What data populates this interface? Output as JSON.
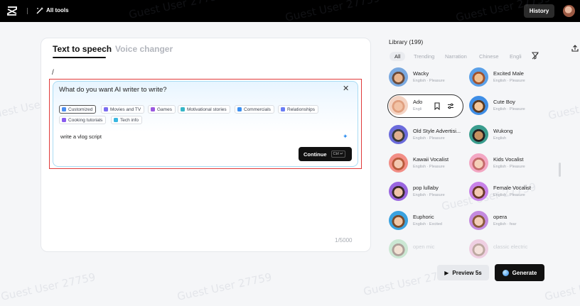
{
  "topbar": {
    "all_tools_label": "All tools",
    "history_label": "History"
  },
  "watermark_text": "Guest User 27759",
  "editor": {
    "tabs": [
      {
        "label": "Text to speech",
        "active": true
      },
      {
        "label": "Voice changer",
        "active": false
      }
    ],
    "text_content": "/",
    "char_counter": "1/5000"
  },
  "ai_writer": {
    "title": "What do you want AI writer to write?",
    "chips": [
      {
        "label": "Customized",
        "active": true,
        "color": "#4a8df0"
      },
      {
        "label": "Movies and TV",
        "active": false,
        "color": "#7a6cf0"
      },
      {
        "label": "Games",
        "active": false,
        "color": "#9b59e0"
      },
      {
        "label": "Motivational stories",
        "active": false,
        "color": "#36b6c8"
      },
      {
        "label": "Commercials",
        "active": false,
        "color": "#3b8ff0"
      },
      {
        "label": "Relationships",
        "active": false,
        "color": "#6a7df5"
      },
      {
        "label": "Cooking tutorials",
        "active": false,
        "color": "#8a5cf0"
      },
      {
        "label": "Tech info",
        "active": false,
        "color": "#3ab7e0"
      }
    ],
    "prompt_text": "write a vlog script",
    "continue_label": "Continue",
    "shortcut_label": "Ctrl ↵"
  },
  "library": {
    "title": "Library (199)",
    "filters": [
      {
        "label": "All",
        "active": true
      },
      {
        "label": "Trending",
        "active": false
      },
      {
        "label": "Narration",
        "active": false
      },
      {
        "label": "Chinese",
        "active": false
      },
      {
        "label": "Engli",
        "active": false
      }
    ],
    "voices": [
      {
        "name": "Wacky",
        "sub": "English · Pleasure",
        "skin": "#e9b58e",
        "hair": "#6a4a3a",
        "bg": "#7aa9e0"
      },
      {
        "name": "Excited Male",
        "sub": "English · Pleasure",
        "skin": "#f0c090",
        "hair": "#a0522d",
        "bg": "#5aa0e8"
      },
      {
        "name": "Ado",
        "sub": "Engli",
        "skin": "#f2c2a5",
        "hair": "#e0a080",
        "bg": "#f4d4c4"
      },
      {
        "name": "Cute Boy",
        "sub": "English · Pleasure",
        "skin": "#f5c79a",
        "hair": "#5a3a22",
        "bg": "#3f8ee6"
      },
      {
        "name": "Old Style Advertisi...",
        "sub": "English · Pleasure",
        "skin": "#e0b090",
        "hair": "#3a3a3a",
        "bg": "#6b6bdc"
      },
      {
        "name": "Wukong",
        "sub": "English",
        "skin": "#c69060",
        "hair": "#222222",
        "bg": "#3a9d8e"
      },
      {
        "name": "Kawaii Vocalist",
        "sub": "English · Pleasure",
        "skin": "#f3c8b0",
        "hair": "#b85a3a",
        "bg": "#f28e86"
      },
      {
        "name": "Kids Vocalist",
        "sub": "English · Pleasure",
        "skin": "#f5d0b8",
        "hair": "#c46a6a",
        "bg": "#f3a7c3"
      },
      {
        "name": "pop lullaby",
        "sub": "English · Pleasure",
        "skin": "#f1c4a8",
        "hair": "#3a2a2a",
        "bg": "#9a66e0"
      },
      {
        "name": "Female Vocalist",
        "sub": "English · Pleasure",
        "skin": "#f3c8b2",
        "hair": "#6a3a2a",
        "bg": "#c882e8"
      },
      {
        "name": "Euphoric",
        "sub": "English · Excited",
        "skin": "#f1c6a6",
        "hair": "#7a4a2a",
        "bg": "#3aa2e0"
      },
      {
        "name": "opera",
        "sub": "English · fear",
        "skin": "#f3cdb8",
        "hair": "#8a5a3a",
        "bg": "#c48adf"
      },
      {
        "name": "open mic",
        "sub": "",
        "skin": "#f0c8a8",
        "hair": "#5a3a2a",
        "bg": "#9ad6a8"
      },
      {
        "name": "classic electric",
        "sub": "",
        "skin": "#f3c8b8",
        "hair": "#7a4a3a",
        "bg": "#e8a0c8"
      }
    ]
  },
  "actions": {
    "preview_label": "Preview 5s",
    "generate_label": "Generate"
  }
}
